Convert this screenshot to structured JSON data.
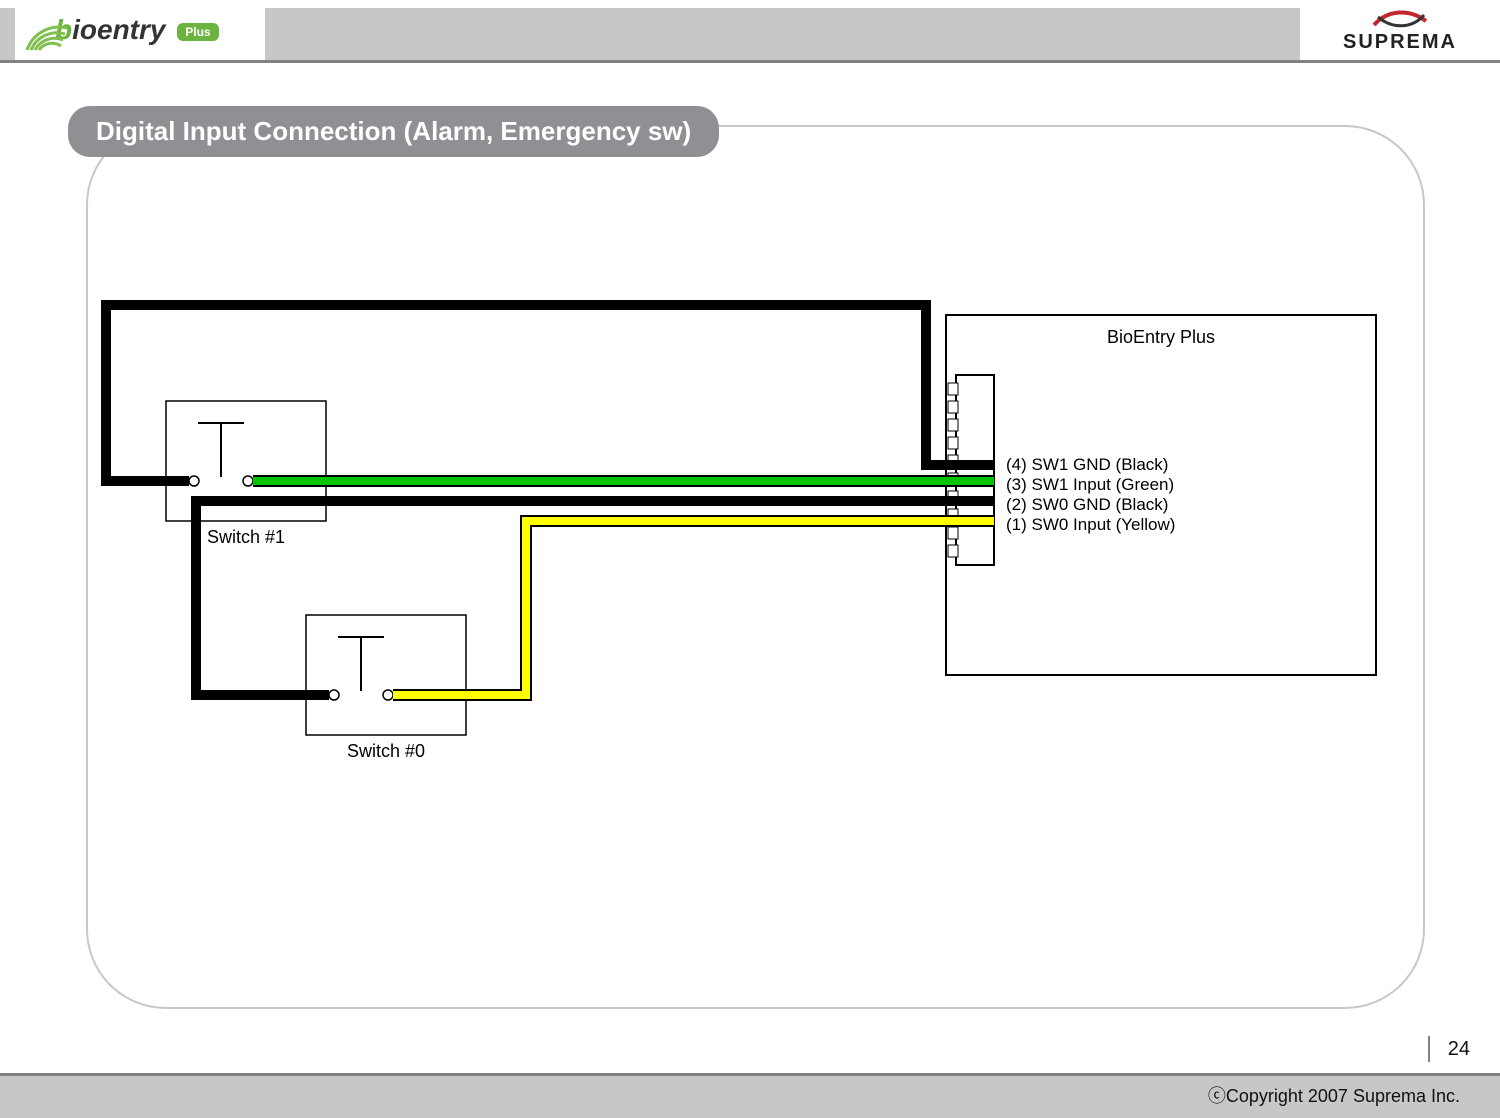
{
  "header": {
    "logo_left_text": "bioentry",
    "logo_left_pill": "Plus",
    "logo_right_text": "SUPREMA"
  },
  "title": "Digital Input Connection (Alarm, Emergency sw)",
  "diagram": {
    "device_label": "BioEntry Plus",
    "switch1_label": "Switch #1",
    "switch0_label": "Switch #0",
    "pins": {
      "p4": "(4) SW1 GND (Black)",
      "p3": "(3) SW1 Input (Green)",
      "p2": "(2) SW0 GND (Black)",
      "p1": "(1) SW0 Input (Yellow)"
    }
  },
  "footer": {
    "page": "24",
    "copyright": "ⓒCopyright 2007 Suprema Inc."
  }
}
